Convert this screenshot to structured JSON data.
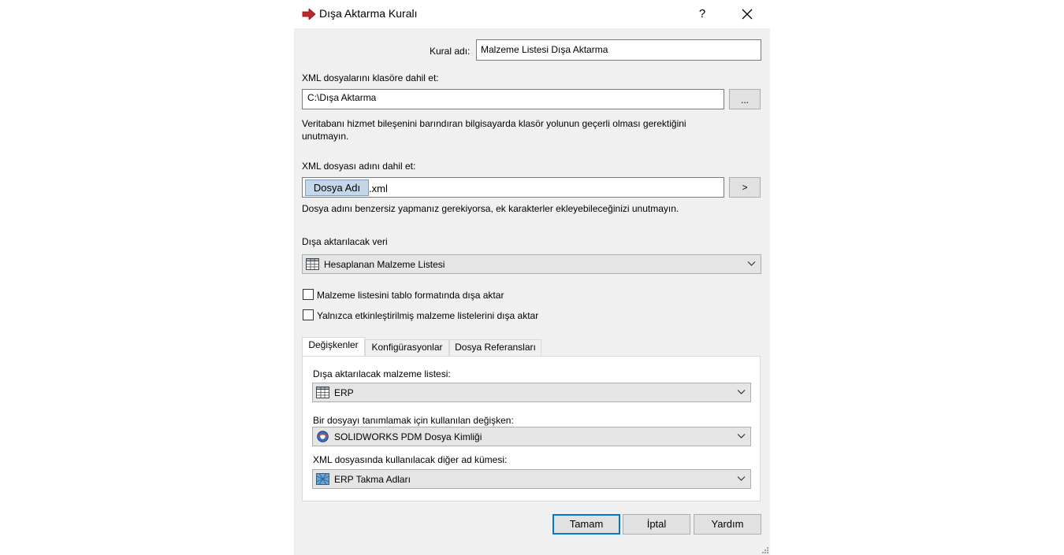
{
  "window": {
    "title": "Dışa Aktarma Kuralı",
    "help": "?"
  },
  "rule_name": {
    "label": "Kural adı:",
    "value": "Malzeme Listesi Dışa Aktarma"
  },
  "folder": {
    "label": "XML dosyalarını klasöre dahil et:",
    "value": "C:\\Dışa Aktarma",
    "browse_label": "...",
    "note": "Veritabanı hizmet bileşenini barındıran bilgisayarda klasör yolunun geçerli olması gerektiğini unutmayın."
  },
  "filename": {
    "label": "XML dosyası adını dahil et:",
    "token": "Dosya Adı",
    "suffix": ".xml",
    "insert_label": ">",
    "note": "Dosya adını benzersiz yapmanız gerekiyorsa, ek karakterler ekleyebileceğinizi unutmayın."
  },
  "export_data": {
    "label": "Dışa aktarılacak veri",
    "selected": "Hesaplanan Malzeme Listesi",
    "icon": "table-icon"
  },
  "options": [
    {
      "label": "Malzeme listesini tablo formatında dışa aktar",
      "checked": false
    },
    {
      "label": "Yalnızca etkinleştirilmiş malzeme listelerini dışa aktar",
      "checked": false
    }
  ],
  "tabs": [
    {
      "label": "Değişkenler",
      "active": true
    },
    {
      "label": "Konfigürasyonlar",
      "active": false
    },
    {
      "label": "Dosya Referansları",
      "active": false
    }
  ],
  "variables": {
    "bom_label": "Dışa aktarılacak malzeme listesi:",
    "bom_selected": "ERP",
    "bom_icon": "table-icon",
    "id_label": "Bir dosyayı tanımlamak için kullanılan değişken:",
    "id_selected": "SOLIDWORKS PDM Dosya Kimliği",
    "id_icon": "pdm-variable-icon",
    "alias_label": "XML dosyasında kullanılacak diğer ad kümesi:",
    "alias_selected": "ERP Takma Adları",
    "alias_icon": "alias-set-icon"
  },
  "buttons": {
    "ok": "Tamam",
    "cancel": "İptal",
    "help": "Yardım"
  },
  "colors": {
    "title_arrow": "#c0282d",
    "default_button_border": "#0078d7",
    "dialog_bg": "#f0f0f0"
  }
}
